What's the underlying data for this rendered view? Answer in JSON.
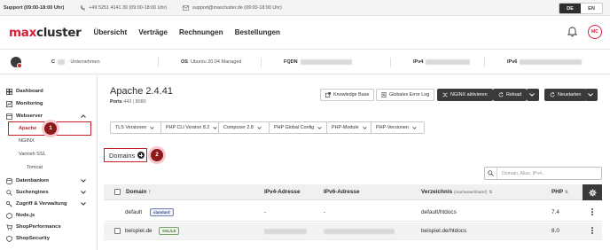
{
  "topbar": {
    "support": "Support (09:00-18:00 Uhr)",
    "phone": "+49 5251 4141 30 (09:00-18:00 Uhr)",
    "email": "support@maxcluster.de (09:00-18:00 Uhr)",
    "lang_active": "DE",
    "lang_other": "EN"
  },
  "nav": {
    "logo_max": "max",
    "logo_cluster": "cluster",
    "items": [
      "Übersicht",
      "Verträge",
      "Rechnungen",
      "Bestellungen"
    ],
    "avatar": "MC"
  },
  "serverbar": {
    "cluster_label": "C",
    "company": "· Unternehmen",
    "os_label": "OS",
    "os_value": "Ubuntu 20.04 Managed",
    "fqdn_label": "FQDN",
    "ipv4_label": "IPv4",
    "ipv6_label": "IPv6"
  },
  "sidebar": {
    "dashboard": "Dashboard",
    "monitoring": "Monitoring",
    "webserver": "Webserver",
    "apache": "Apache",
    "nginx": "NGINX",
    "varnish": "Varnish SSL",
    "tomcat": "Tomcat",
    "datenbanken": "Datenbanken",
    "suchengines": "Suchengines",
    "zugriff": "Zugriff & Verwaltung",
    "nodejs": "Node.js",
    "shopperformance": "ShopPerformance",
    "shopsecurity": "ShopSecurity"
  },
  "annotations": {
    "one": "1",
    "two": "2"
  },
  "main": {
    "title": "Apache 2.4.41",
    "ports_label": "Ports",
    "ports_value": "443 | 8080",
    "knowledge_base": "Knowledge Base",
    "error_log": "Globales Error Log",
    "nginx_activate": "NGINX aktivieren",
    "reload": "Reload",
    "restart": "Neustarten",
    "selects": [
      "TLS Versionen",
      "PHP CLI Version 8.2",
      "Composer 2.8",
      "PHP Global Config",
      "PHP-Module",
      "PHP-Versionen"
    ],
    "domains_heading": "Domains",
    "search_placeholder": "Domain, Alias, IPv4..."
  },
  "table": {
    "headers": {
      "domain": "Domain",
      "ipv4": "IPv4-Adresse",
      "ipv6": "IPv6-Adresse",
      "dir": "Verzeichnis",
      "dir_hint": "(/var/www/share/)",
      "php": "PHP"
    },
    "rows": [
      {
        "domain": "default",
        "tag": "standard",
        "ipv4": "-",
        "ipv6": "-",
        "dir": "default/htdocs",
        "php": "7.4"
      },
      {
        "domain": "beispiel.de",
        "tag": "SSL/LE",
        "ipv4": "",
        "ipv6": "",
        "dir": "beispiel.de/htdocs",
        "php": "8.0"
      }
    ]
  }
}
